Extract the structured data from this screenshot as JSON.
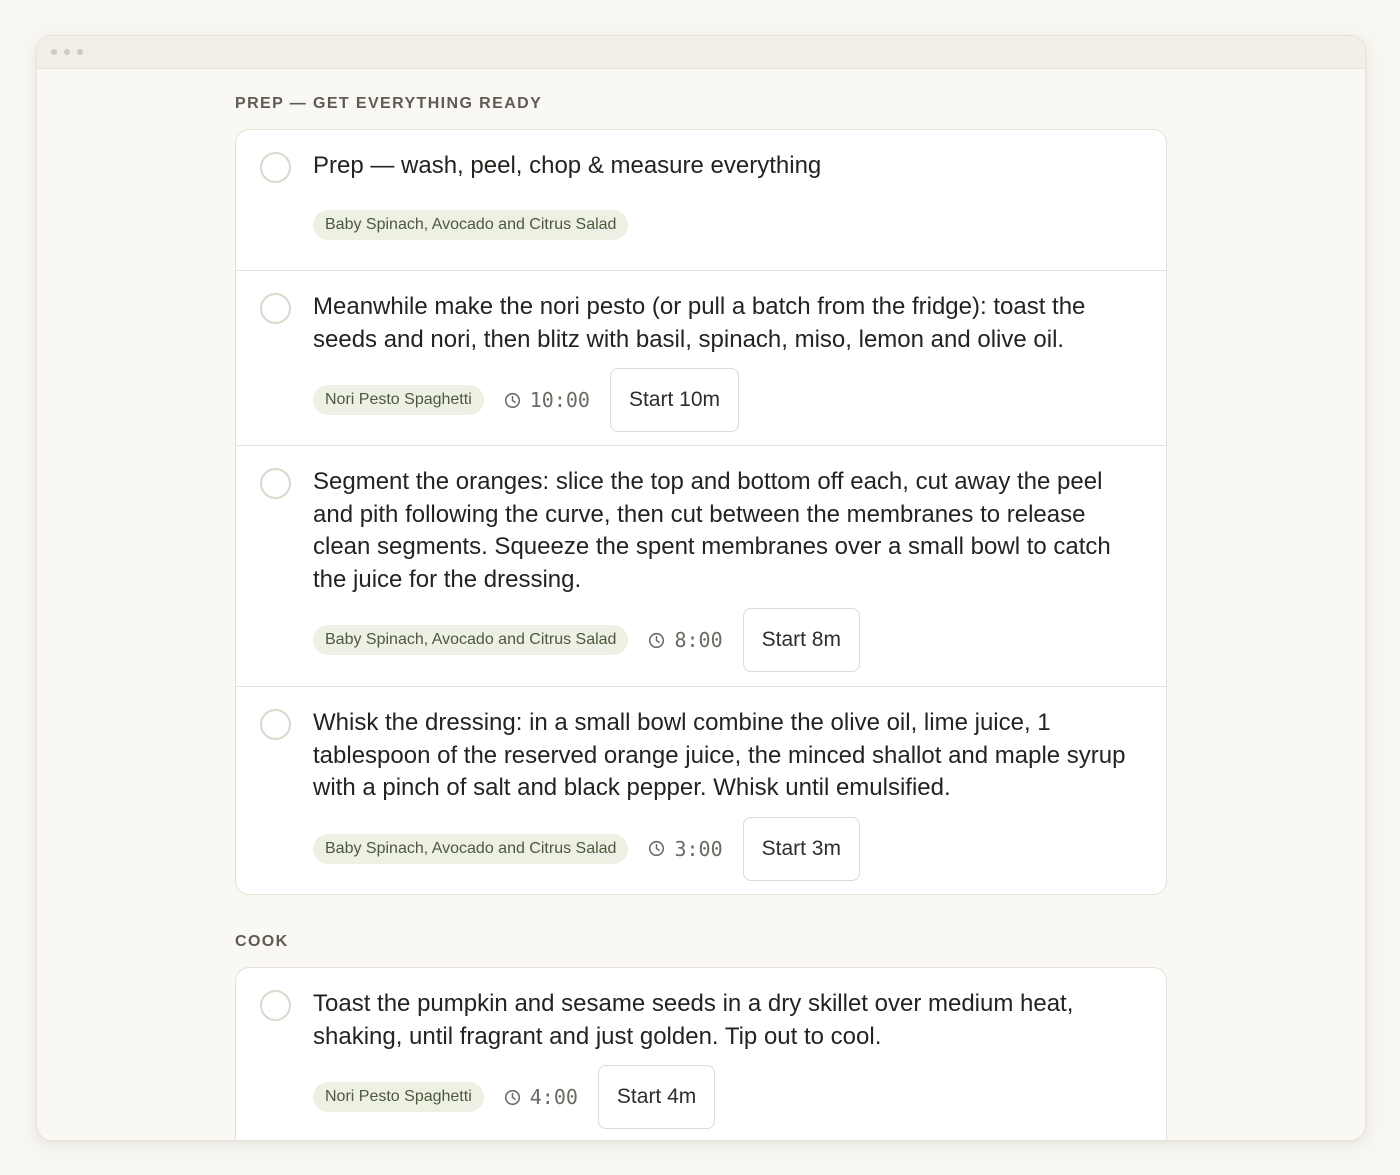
{
  "sections": [
    {
      "title": "PREP — GET EVERYTHING READY",
      "steps": [
        {
          "text": "Prep — wash, peel, chop & measure everything",
          "recipe": "Baby Spinach, Avocado and Citrus Salad"
        },
        {
          "text": "Meanwhile make the nori pesto (or pull a batch from the fridge): toast the seeds and nori, then blitz with basil, spinach, miso, lemon and olive oil.",
          "recipe": "Nori Pesto Spaghetti",
          "time": "10:00",
          "start_label": "Start 10m"
        },
        {
          "text": "Segment the oranges: slice the top and bottom off each, cut away the peel and pith following the curve, then cut between the membranes to release clean segments. Squeeze the spent membranes over a small bowl to catch the juice for the dressing.",
          "recipe": "Baby Spinach, Avocado and Citrus Salad",
          "time": "8:00",
          "start_label": "Start 8m"
        },
        {
          "text": "Whisk the dressing: in a small bowl combine the olive oil, lime juice, 1 tablespoon of the reserved orange juice, the minced shallot and maple syrup with a pinch of salt and black pepper. Whisk until emulsified.",
          "recipe": "Baby Spinach, Avocado and Citrus Salad",
          "time": "3:00",
          "start_label": "Start 3m"
        }
      ]
    },
    {
      "title": "COOK",
      "steps": [
        {
          "text": "Toast the pumpkin and sesame seeds in a dry skillet over medium heat, shaking, until fragrant and just golden. Tip out to cool.",
          "recipe": "Nori Pesto Spaghetti",
          "time": "4:00",
          "start_label": "Start 4m"
        }
      ]
    }
  ],
  "icons": {
    "checkbox": "circle-checkbox-icon",
    "timer": "clock-icon"
  },
  "colors": {
    "page_bg": "#f8f6f0",
    "card_bg": "#ffffff",
    "tag_bg": "#eef0e4",
    "tag_text": "#4a5a3c",
    "section_title": "#5d5b54"
  }
}
